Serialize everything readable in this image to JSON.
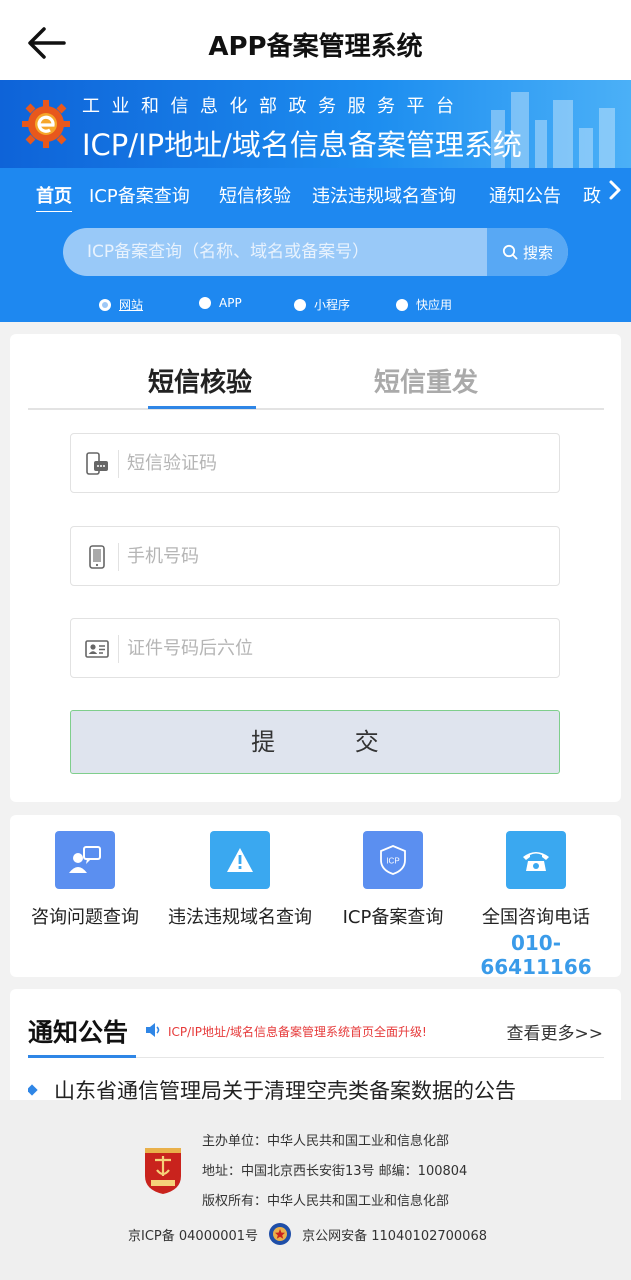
{
  "appbar": {
    "title": "APP备案管理系统",
    "back_icon": "arrow-left-icon"
  },
  "banner": {
    "subtitle": "工业和信息化部政务服务平台",
    "title": "ICP/IP地址/域名信息备案管理系统",
    "logo_icon": "gear-e-logo-icon"
  },
  "nav": {
    "items": [
      "首页",
      "ICP备案查询",
      "短信核验",
      "违法违规域名查询",
      "通知公告",
      "政"
    ],
    "active_index": 0,
    "more_icon": "chevron-right-icon"
  },
  "search": {
    "placeholder": "ICP备案查询（名称、域名或备案号）",
    "value": "",
    "button_label": "搜索",
    "icon": "search-icon"
  },
  "types": [
    {
      "label": "网站",
      "selected": true
    },
    {
      "label": "APP",
      "selected": false
    },
    {
      "label": "小程序",
      "selected": false
    },
    {
      "label": "快应用",
      "selected": false
    }
  ],
  "form": {
    "tabs": [
      {
        "label": "短信核验",
        "active": true
      },
      {
        "label": "短信重发",
        "active": false
      }
    ],
    "fields": [
      {
        "placeholder": "短信验证码",
        "value": "",
        "icon": "sms-phone-icon"
      },
      {
        "placeholder": "手机号码",
        "value": "",
        "icon": "mobile-phone-icon"
      },
      {
        "placeholder": "证件号码后六位",
        "value": "",
        "icon": "id-card-icon"
      }
    ],
    "submit_label": "提 交"
  },
  "quick_links": [
    {
      "label": "咨询问题查询",
      "icon": "consult-chat-icon",
      "color": "#5b8ff0"
    },
    {
      "label": "违法违规域名查询",
      "icon": "warning-icon",
      "color": "#3aa8f0"
    },
    {
      "label": "ICP备案查询",
      "icon": "icp-shield-icon",
      "color": "#5b8ff0"
    },
    {
      "label": "全国咨询电话",
      "icon": "telephone-icon",
      "color": "#3aa8f0",
      "phone": "010-66411166"
    }
  ],
  "notice": {
    "title": "通知公告",
    "marquee": "ICP/IP地址/域名信息备案管理系统首页全面升级!",
    "more_label": "查看更多>>",
    "items": [
      "山东省通信管理局关于清理空壳类备案数据的公告"
    ]
  },
  "footer": {
    "sponsor": "主办单位：中华人民共和国工业和信息化部",
    "address": "地址：中国北京西长安街13号 邮编：100804",
    "copyright": "版权所有：中华人民共和国工业和信息化部",
    "icp": "京ICP备 04000001号",
    "police": "京公网安备 11040102700068",
    "badge_icon": "party-gov-badge-icon",
    "police_icon": "police-emblem-icon"
  },
  "colors": {
    "primary": "#1e88f0",
    "accent": "#2f86e6",
    "phone": "#3a9be9",
    "alert": "#e63a3a"
  }
}
